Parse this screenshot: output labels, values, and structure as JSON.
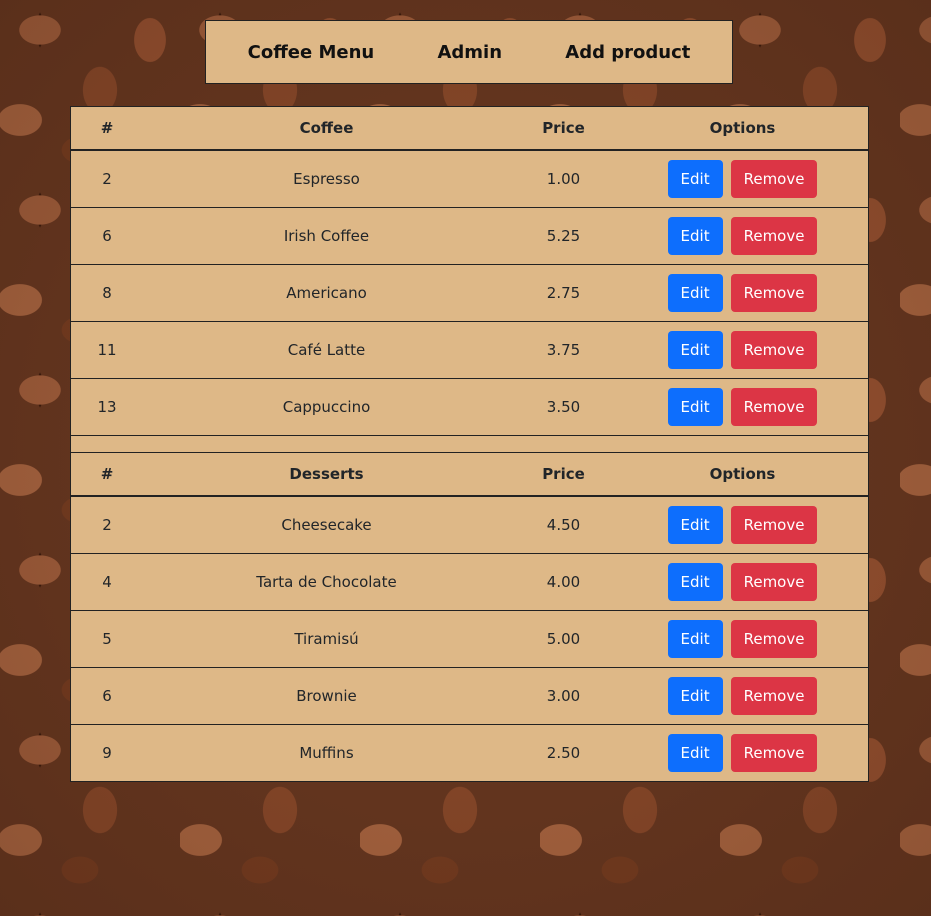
{
  "nav": {
    "items": [
      {
        "label": "Coffee Menu"
      },
      {
        "label": "Admin"
      },
      {
        "label": "Add product"
      }
    ]
  },
  "colors": {
    "panel": "#deb887",
    "edit": "#0d6efd",
    "remove": "#dc3545"
  },
  "coffee": {
    "headers": {
      "id": "#",
      "name": "Coffee",
      "price": "Price",
      "options": "Options"
    },
    "rows": [
      {
        "id": "2",
        "name": "Espresso",
        "price": "1.00"
      },
      {
        "id": "6",
        "name": "Irish Coffee",
        "price": "5.25"
      },
      {
        "id": "8",
        "name": "Americano",
        "price": "2.75"
      },
      {
        "id": "11",
        "name": "Café Latte",
        "price": "3.75"
      },
      {
        "id": "13",
        "name": "Cappuccino",
        "price": "3.50"
      }
    ]
  },
  "desserts": {
    "headers": {
      "id": "#",
      "name": "Desserts",
      "price": "Price",
      "options": "Options"
    },
    "rows": [
      {
        "id": "2",
        "name": "Cheesecake",
        "price": "4.50"
      },
      {
        "id": "4",
        "name": "Tarta de Chocolate",
        "price": "4.00"
      },
      {
        "id": "5",
        "name": "Tiramisú",
        "price": "5.00"
      },
      {
        "id": "6",
        "name": "Brownie",
        "price": "3.00"
      },
      {
        "id": "9",
        "name": "Muffins",
        "price": "2.50"
      }
    ]
  },
  "actions": {
    "edit_label": "Edit",
    "remove_label": "Remove"
  }
}
